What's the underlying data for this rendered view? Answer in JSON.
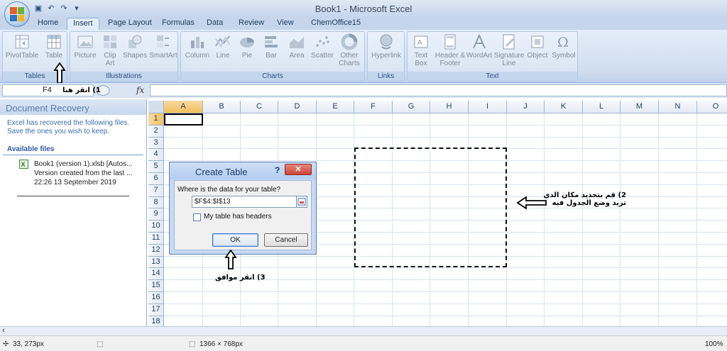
{
  "window": {
    "title": "Book1 - Microsoft Excel"
  },
  "qat": {
    "save_icon": "save-icon",
    "undo_icon": "undo-icon",
    "redo_icon": "redo-icon",
    "customize_icon": "customize-qat-icon"
  },
  "tabs": [
    {
      "label": "Home",
      "active": false
    },
    {
      "label": "Insert",
      "active": true
    },
    {
      "label": "Page Layout",
      "active": false
    },
    {
      "label": "Formulas",
      "active": false
    },
    {
      "label": "Data",
      "active": false
    },
    {
      "label": "Review",
      "active": false
    },
    {
      "label": "View",
      "active": false
    },
    {
      "label": "ChemOffice15",
      "active": false
    }
  ],
  "ribbon": {
    "groups": {
      "tables": "Tables",
      "illustrations": "Illustrations",
      "charts": "Charts",
      "links": "Links",
      "text": "Text"
    },
    "buttons": {
      "pivottable": "PivotTable",
      "table": "Table",
      "picture": "Picture",
      "clipart": "Clip Art",
      "shapes": "Shapes",
      "smartart": "SmartArt",
      "column": "Column",
      "line": "Line",
      "pie": "Pie",
      "bar": "Bar",
      "area": "Area",
      "scatter": "Scatter",
      "other": "Other Charts",
      "hyperlink": "Hyperlink",
      "textbox": "Text Box",
      "headerfooter": "Header & Footer",
      "wordart": "WordArt",
      "signature": "Signature Line",
      "object": "Object",
      "symbol": "Symbol"
    }
  },
  "formula_bar": {
    "name_box": "F4",
    "fx": "fx",
    "value": ""
  },
  "recovery": {
    "title": "Document Recovery",
    "description": "Excel has recovered the following files.  Save the ones you wish to keep.",
    "available_label": "Available files",
    "file_name": "Book1 (version 1).xlsb  [Autos...",
    "file_note": "Version created from the last ...",
    "file_time": "22:26 13 September 2019"
  },
  "grid": {
    "columns": [
      "A",
      "B",
      "C",
      "D",
      "E",
      "F",
      "G",
      "H",
      "I",
      "J",
      "K",
      "L",
      "M",
      "N",
      "O"
    ],
    "rows": [
      "1",
      "2",
      "3",
      "4",
      "5",
      "6",
      "7",
      "8",
      "9",
      "10",
      "11",
      "12",
      "13",
      "14",
      "15",
      "16",
      "17",
      "18"
    ],
    "selected_column": "A",
    "selected_row": "1"
  },
  "dialog": {
    "title": "Create Table",
    "help": "?",
    "close": "✕",
    "prompt": "Where is the data for your table?",
    "range_value": "$F$4:$I$13",
    "checkbox_label": "My table has headers",
    "checkbox_checked": false,
    "ok_label": "OK",
    "cancel_label": "Cancel"
  },
  "annotations": {
    "step1": "1) انقر هنا",
    "step2_line1": "2) قم بتحديد مكان الذي",
    "step2_line2": "تريد وضع الجدول فيه",
    "step3": "3) انقر موافق"
  },
  "statusbar": {
    "cursor_pos": "33, 273px",
    "dimensions": "1366 × 768px",
    "zoom": "100%"
  },
  "colors": {
    "accent": "#c5d6ec",
    "selection": "#f1c15f",
    "close": "#c9443a"
  }
}
